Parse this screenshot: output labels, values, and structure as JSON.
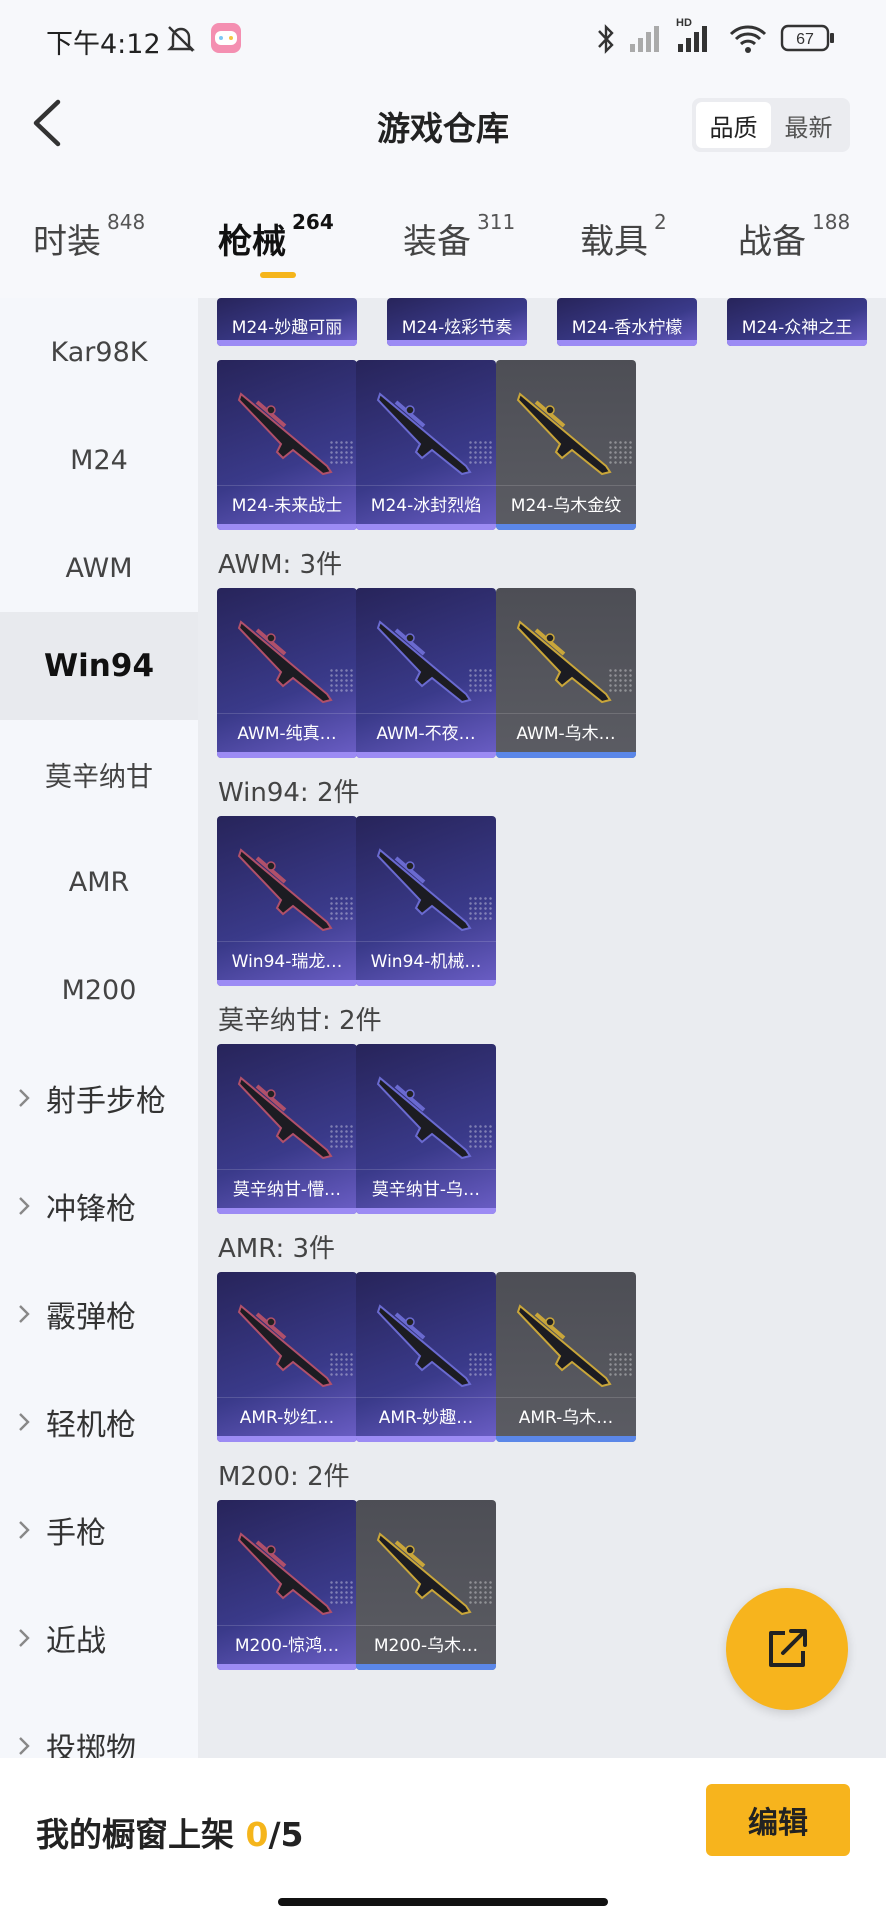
{
  "status": {
    "time": "下午4:12",
    "battery": "67",
    "network": "HD"
  },
  "header": {
    "title": "游戏仓库",
    "sort_options": [
      "品质",
      "最新"
    ],
    "selected_sort": "品质"
  },
  "tabs": [
    {
      "label": "时装",
      "count": "848"
    },
    {
      "label": "枪械",
      "count": "264"
    },
    {
      "label": "装备",
      "count": "311"
    },
    {
      "label": "载具",
      "count": "2"
    },
    {
      "label": "战备",
      "count": "188"
    }
  ],
  "active_tab": "枪械",
  "sidebar": {
    "selected": "Win94",
    "items": [
      "Kar98K",
      "M24",
      "AWM",
      "Win94",
      "莫辛纳甘",
      "AMR",
      "M200"
    ],
    "categories": [
      "射手步枪",
      "冲锋枪",
      "霰弹枪",
      "轻机枪",
      "手枪",
      "近战",
      "投掷物"
    ]
  },
  "top_row": [
    "M24-妙趣可丽",
    "M24-炫彩节奏",
    "M24-香水柠檬",
    "M24-众神之王"
  ],
  "sections": [
    {
      "title": "",
      "items": [
        {
          "name": "M24-未来战士",
          "quality": "purple",
          "icon": "rifle-skin-icon"
        },
        {
          "name": "M24-冰封烈焰",
          "quality": "purple",
          "icon": "rifle-skin-icon"
        },
        {
          "name": "M24-乌木金纹",
          "quality": "grey",
          "icon": "rifle-skin-icon"
        }
      ]
    },
    {
      "title": "AWM: 3件",
      "items": [
        {
          "name": "AWM-纯真…",
          "quality": "purple",
          "icon": "rifle-skin-icon"
        },
        {
          "name": "AWM-不夜…",
          "quality": "purple",
          "icon": "rifle-skin-icon"
        },
        {
          "name": "AWM-乌木…",
          "quality": "grey",
          "icon": "rifle-skin-icon"
        }
      ]
    },
    {
      "title": "Win94: 2件",
      "items": [
        {
          "name": "Win94-瑞龙…",
          "quality": "purple",
          "icon": "rifle-skin-icon"
        },
        {
          "name": "Win94-机械…",
          "quality": "purple",
          "icon": "rifle-skin-icon"
        }
      ]
    },
    {
      "title": "莫辛纳甘: 2件",
      "items": [
        {
          "name": "莫辛纳甘-懵…",
          "quality": "purple",
          "icon": "rifle-skin-icon"
        },
        {
          "name": "莫辛纳甘-乌…",
          "quality": "purple",
          "icon": "rifle-skin-icon"
        }
      ]
    },
    {
      "title": "AMR: 3件",
      "items": [
        {
          "name": "AMR-妙红…",
          "quality": "purple",
          "icon": "rifle-skin-icon"
        },
        {
          "name": "AMR-妙趣…",
          "quality": "purple",
          "icon": "rifle-skin-icon"
        },
        {
          "name": "AMR-乌木…",
          "quality": "grey",
          "icon": "rifle-skin-icon"
        }
      ]
    },
    {
      "title": "M200: 2件",
      "items": [
        {
          "name": "M200-惊鸿…",
          "quality": "purple",
          "icon": "rifle-skin-icon"
        },
        {
          "name": "M200-乌木…",
          "quality": "grey",
          "icon": "rifle-skin-icon"
        }
      ]
    }
  ],
  "bottom": {
    "label": "我的橱窗上架",
    "used": "0",
    "total": "/5",
    "edit_label": "编辑"
  },
  "colors": {
    "accent": "#f7b41d",
    "purple_card": "#3a3a8a",
    "grey_card": "#55565c"
  }
}
